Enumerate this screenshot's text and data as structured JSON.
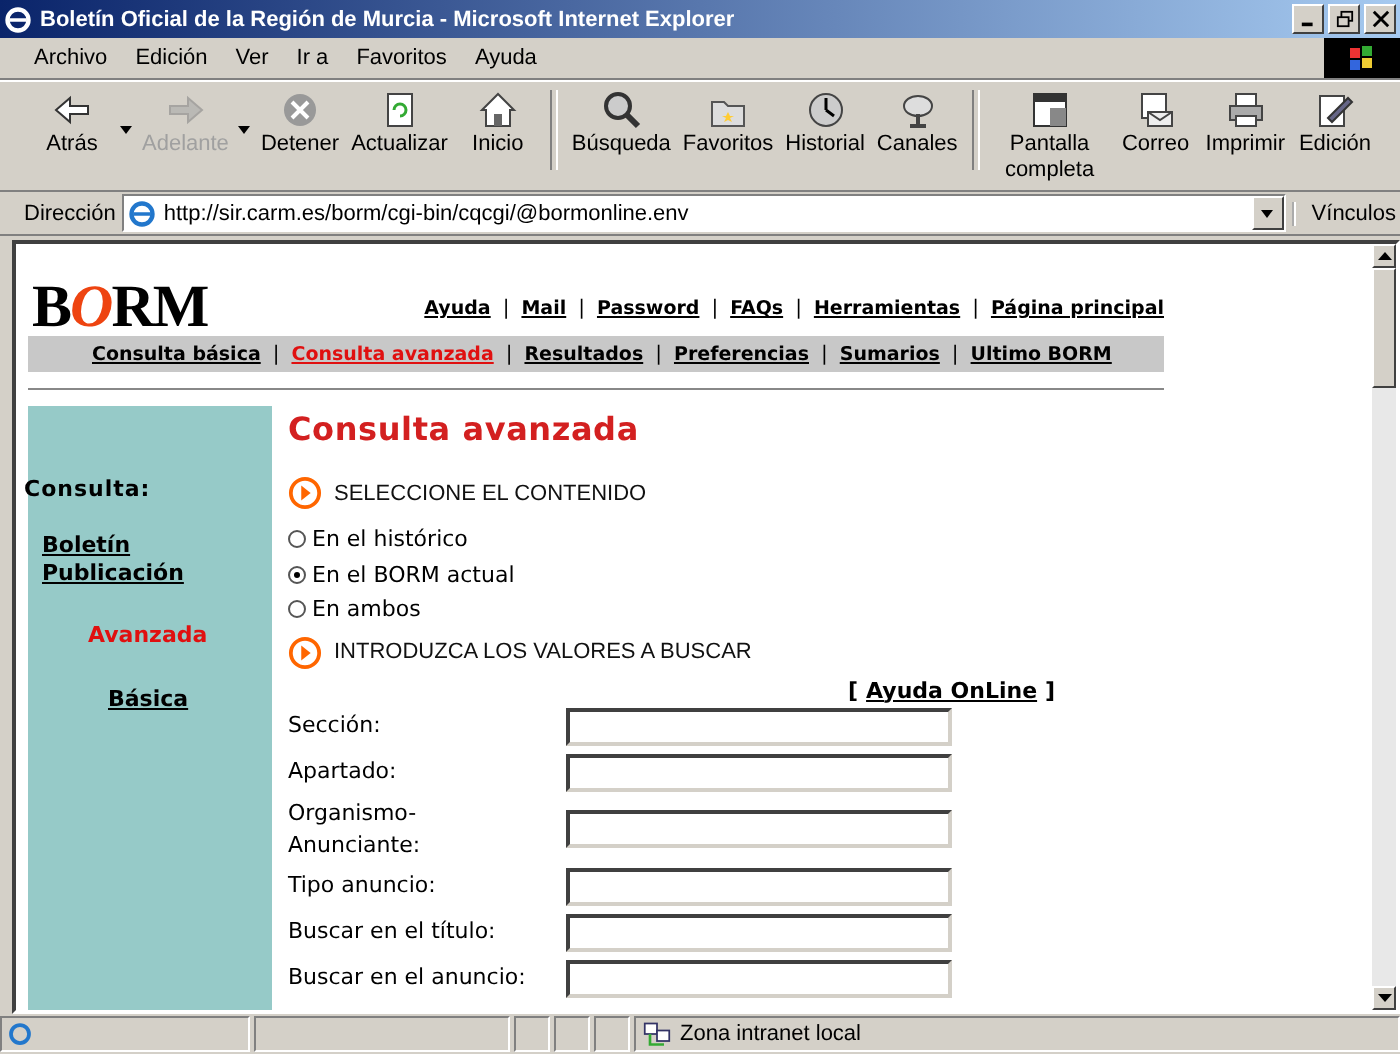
{
  "window": {
    "title": "Boletín Oficial de la Región de Murcia - Microsoft Internet Explorer"
  },
  "menu": [
    "Archivo",
    "Edición",
    "Ver",
    "Ir a",
    "Favoritos",
    "Ayuda"
  ],
  "toolbar": [
    {
      "label": "Atrás",
      "disabled": false,
      "has_menu": true
    },
    {
      "label": "Adelante",
      "disabled": true,
      "has_menu": true
    },
    {
      "label": "Detener",
      "disabled": false,
      "has_menu": false
    },
    {
      "label": "Actualizar",
      "disabled": false,
      "has_menu": false
    },
    {
      "label": "Inicio",
      "disabled": false,
      "has_menu": false
    },
    {
      "label": "Búsqueda",
      "disabled": false,
      "has_menu": false
    },
    {
      "label": "Favoritos",
      "disabled": false,
      "has_menu": false
    },
    {
      "label": "Historial",
      "disabled": false,
      "has_menu": false
    },
    {
      "label": "Canales",
      "disabled": false,
      "has_menu": false
    },
    {
      "label": "Pantalla completa",
      "disabled": false,
      "has_menu": false
    },
    {
      "label": "Correo",
      "disabled": false,
      "has_menu": false
    },
    {
      "label": "Imprimir",
      "disabled": false,
      "has_menu": false
    },
    {
      "label": "Edición",
      "disabled": false,
      "has_menu": false
    }
  ],
  "address_bar": {
    "label": "Dirección",
    "value": "http://sir.carm.es/borm/cgi-bin/cqcgi/@bormonline.env",
    "links_label": "Vínculos"
  },
  "page": {
    "logo_left": "B",
    "logo_mid": "O",
    "logo_right": "RM",
    "separator": "|",
    "top_links": [
      "Ayuda",
      "Mail",
      "Password",
      "FAQs",
      "Herramientas",
      "Página principal"
    ],
    "nav": [
      {
        "label": "Consulta básica",
        "selected": false
      },
      {
        "label": "Consulta avanzada",
        "selected": true
      },
      {
        "label": "Resultados",
        "selected": false
      },
      {
        "label": "Preferencias",
        "selected": false
      },
      {
        "label": "Sumarios",
        "selected": false
      },
      {
        "label": "Ultimo BORM",
        "selected": false
      }
    ],
    "sidebar": {
      "heading": "Consulta:",
      "items": [
        {
          "label": "Boletín Publicación",
          "selected": false
        },
        {
          "label": "Avanzada",
          "selected": true
        },
        {
          "label": "Básica",
          "selected": false
        }
      ]
    },
    "heading": "Consulta avanzada",
    "section_1": "SELECCIONE EL CONTENIDO",
    "options": [
      {
        "label": "En el histórico",
        "selected": false
      },
      {
        "label": "En el BORM actual",
        "selected": true
      },
      {
        "label": "En ambos",
        "selected": false
      }
    ],
    "section_2": "INTRODUZCA LOS VALORES A BUSCAR",
    "help_link": "Ayuda OnLine",
    "help_open": "[",
    "help_close": "]",
    "fields": [
      {
        "label": "Sección:"
      },
      {
        "label": "Apartado:"
      },
      {
        "label": "Organismo-Anunciante:"
      },
      {
        "label": "Tipo anuncio:"
      },
      {
        "label": "Buscar en el título:"
      },
      {
        "label": "Buscar en el anuncio:"
      }
    ]
  },
  "status_bar": {
    "zone": "Zona intranet local"
  }
}
